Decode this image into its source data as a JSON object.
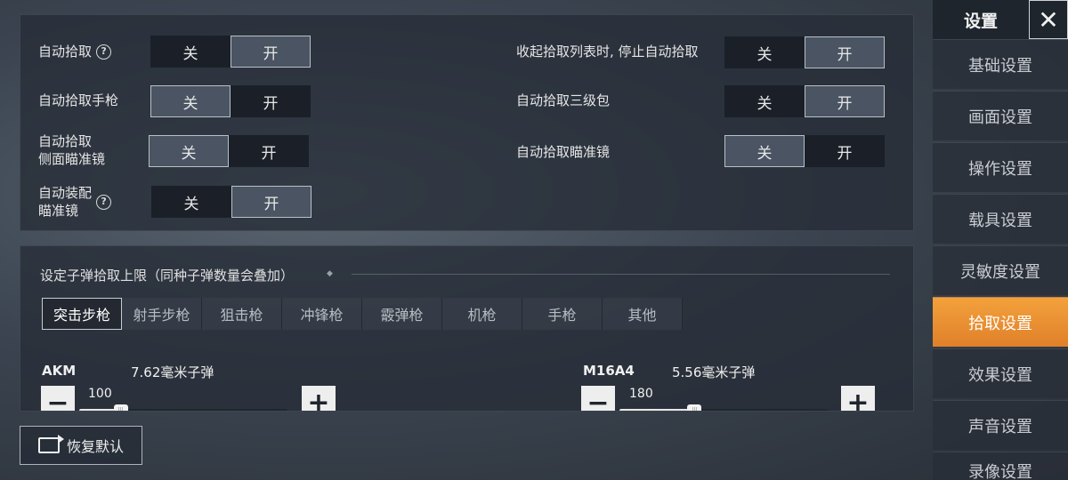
{
  "toggle_labels": {
    "off": "关",
    "on": "开"
  },
  "pickup_toggles": {
    "left": [
      {
        "label": "自动拾取",
        "help": "?",
        "active": "on"
      },
      {
        "label": "自动拾取手枪",
        "active": "off"
      },
      {
        "label_line1": "自动拾取",
        "label_line2": "侧面瞄准镜",
        "active": "off"
      },
      {
        "label_line1": "自动装配",
        "label_line2": "瞄准镜",
        "help": "?",
        "active": "on"
      }
    ],
    "right": [
      {
        "label": "收起拾取列表时, 停止自动拾取",
        "active": "on"
      },
      {
        "label": "自动拾取三级包",
        "active": "on"
      },
      {
        "label": "自动拾取瞄准镜",
        "active": "off"
      }
    ]
  },
  "ammo_section": {
    "title": "设定子弹拾取上限（同种子弹数量会叠加）",
    "tabs": [
      "突击步枪",
      "射手步枪",
      "狙击枪",
      "冲锋枪",
      "霰弹枪",
      "机枪",
      "手枪",
      "其他"
    ],
    "active_tab": 0,
    "weapons": [
      {
        "name": "AKM",
        "ammo": "7.62毫米子弹",
        "value": "100",
        "fill": 0.2
      },
      {
        "name": "M16A4",
        "ammo": "5.56毫米子弹",
        "value": "180",
        "fill": 0.36
      }
    ],
    "stepper": {
      "minus": "−",
      "plus": "+"
    }
  },
  "reset_button": {
    "label": "恢复默认"
  },
  "sidebar": {
    "title": "设置",
    "close": "✕",
    "items": [
      "基础设置",
      "画面设置",
      "操作设置",
      "载具设置",
      "灵敏度设置",
      "拾取设置",
      "效果设置",
      "声音设置",
      "录像设置"
    ],
    "active_index": 5
  },
  "colors": {
    "accent": "#f0932f",
    "panel": "#262d37"
  }
}
